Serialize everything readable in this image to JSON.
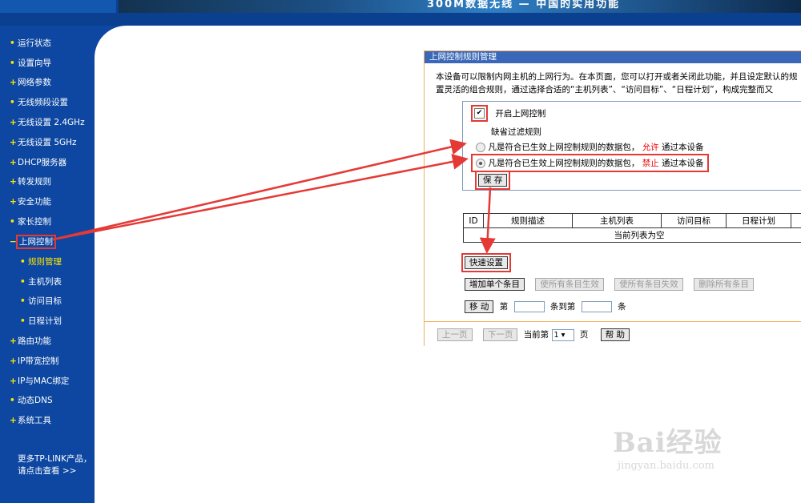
{
  "banner": {
    "slogan": "300M数据无线 — 中国的实用功能"
  },
  "sidebar": {
    "items": [
      {
        "label": "运行状态"
      },
      {
        "label": "设置向导"
      },
      {
        "label": "网络参数"
      },
      {
        "label": "无线频段设置"
      },
      {
        "label": "无线设置 2.4GHz"
      },
      {
        "label": "无线设置 5GHz"
      },
      {
        "label": "DHCP服务器"
      },
      {
        "label": "转发规则"
      },
      {
        "label": "安全功能"
      },
      {
        "label": "家长控制"
      },
      {
        "label": "上网控制"
      },
      {
        "label": "规则管理"
      },
      {
        "label": "主机列表"
      },
      {
        "label": "访问目标"
      },
      {
        "label": "日程计划"
      },
      {
        "label": "路由功能"
      },
      {
        "label": "IP带宽控制"
      },
      {
        "label": "IP与MAC绑定"
      },
      {
        "label": "动态DNS"
      },
      {
        "label": "系统工具"
      }
    ],
    "more_line1": "更多TP-LINK产品，",
    "more_line2": "请点击查看 >>"
  },
  "panel": {
    "title": "上网控制规则管理",
    "desc_line1": "本设备可以限制内网主机的上网行为。在本页面，您可以打开或者关闭此功能，并且设定默认的规",
    "desc_line2": "置灵活的组合规则，通过选择合适的“主机列表”、“访问目标”、“日程计划”，构成完整而又",
    "enable_label": "开启上网控制",
    "default_rule_label": "缺省过滤规则",
    "allow_prefix": "凡是符合已生效上网控制规则的数据包，",
    "allow_word": "允许",
    "allow_suffix": "通过本设备",
    "deny_prefix": "凡是符合已生效上网控制规则的数据包，",
    "deny_word": "禁止",
    "deny_suffix": "通过本设备",
    "save_label": "保 存",
    "table": {
      "headers": [
        "ID",
        "规则描述",
        "主机列表",
        "访问目标",
        "日程计划"
      ],
      "empty_text": "当前列表为空"
    },
    "quick_setup_label": "快速设置",
    "add_label": "增加单个条目",
    "enable_all_label": "使所有条目生效",
    "disable_all_label": "使所有条目失效",
    "delete_all_label": "删除所有条目",
    "move_label": "移 动",
    "move_text1": "第",
    "move_text2": "条到第",
    "move_text3": "条",
    "prev_label": "上一页",
    "next_label": "下一页",
    "current_page_text": "当前第",
    "page_value": "1 ▾",
    "page_suffix": "页",
    "help_label": "帮 助"
  },
  "watermark": {
    "brand": "Bai经验",
    "url": "jingyan.baidu.com"
  },
  "colors": {
    "nav_bg": "#0d47a1",
    "highlight": "#e53935",
    "panel_title": "#3a67b8"
  }
}
